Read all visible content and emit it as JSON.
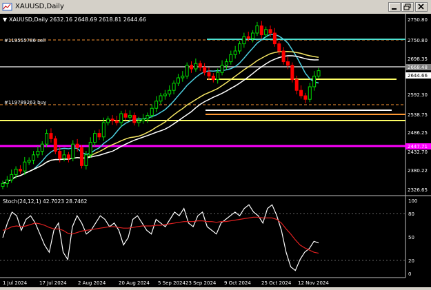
{
  "window": {
    "title": "XAUUSD,Daily",
    "minimize_label": "minimize",
    "restore_label": "restore",
    "close_label": "close"
  },
  "main_chart": {
    "header": {
      "symbol": "XAUUSD,Daily",
      "ohlc": "2632.16 2648.69 2618.81 2644.66"
    },
    "level_labels": [
      {
        "text": "#119555786 sell"
      },
      {
        "text": "#119789263 buy"
      }
    ],
    "price_axis": [
      "2750.80",
      "2698.35",
      "2668.48",
      "2644.66",
      "2592.30",
      "2538.75",
      "2486.25",
      "2432.70",
      "2380.22",
      "2326.65"
    ],
    "magenta_level": "2447.71",
    "current_price": "2644.66",
    "colors": {
      "background": "#000000",
      "candles": "#ff0000",
      "bull_candles": "#00e000",
      "ma_fast": "#4dd0e1",
      "ma_slow": "#ffffff",
      "ma_mid": "#f5e663",
      "level_cyan": "#4de0d0",
      "level_magenta": "#ff00ff",
      "level_yellow": "#ffff66",
      "level_orange": "#ff9933"
    }
  },
  "stoch": {
    "label": "Stoch(24,12,1) 42.7023 28.7462",
    "axis": [
      "100",
      "80",
      "50",
      "20",
      "0"
    ]
  },
  "time_axis": [
    "1 Jul 2024",
    "17 Jul 2024",
    "2 Aug 2024",
    "20 Aug 2024",
    "5 Sep 2024",
    "23 Sep 2024",
    "9 Oct 2024",
    "25 Oct 2024",
    "12 Nov 2024"
  ],
  "chart_data": [
    {
      "type": "candlestick",
      "title": "XAUUSD,Daily",
      "ylim": [
        2300,
        2800
      ],
      "grid": false,
      "series": [
        {
          "name": "price",
          "approx_close": [
            2330,
            2340,
            2355,
            2370,
            2365,
            2390,
            2395,
            2410,
            2420,
            2440,
            2470,
            2455,
            2420,
            2400,
            2410,
            2400,
            2440,
            2430,
            2380,
            2410,
            2445,
            2470,
            2460,
            2500,
            2510,
            2505,
            2500,
            2525,
            2515,
            2520,
            2500,
            2505,
            2510,
            2520,
            2540,
            2560,
            2575,
            2580,
            2590,
            2610,
            2625,
            2630,
            2660,
            2650,
            2665,
            2655,
            2640,
            2630,
            2620,
            2640,
            2660,
            2670,
            2690,
            2700,
            2720,
            2740,
            2735,
            2750,
            2770,
            2745,
            2760,
            2750,
            2720,
            2700,
            2670,
            2660,
            2620,
            2590,
            2575,
            2565,
            2600,
            2630,
            2645
          ]
        }
      ]
    },
    {
      "type": "line",
      "title": "Stoch(24,12,1) 42.7023 28.7462",
      "ylim": [
        0,
        100
      ],
      "series": [
        {
          "name": "main",
          "values": [
            50,
            70,
            85,
            80,
            60,
            75,
            80,
            70,
            55,
            40,
            30,
            60,
            70,
            30,
            20,
            65,
            80,
            70,
            55,
            60,
            70,
            80,
            75,
            65,
            70,
            60,
            40,
            50,
            75,
            80,
            70,
            60,
            55,
            75,
            70,
            65,
            75,
            85,
            80,
            90,
            70,
            65,
            80,
            85,
            65,
            60,
            55,
            70,
            75,
            80,
            85,
            80,
            90,
            95,
            85,
            80,
            70,
            90,
            95,
            80,
            60,
            30,
            10,
            5,
            20,
            30,
            35,
            45,
            42.7
          ]
        },
        {
          "name": "signal",
          "values": [
            60,
            62,
            65,
            66,
            65,
            66,
            68,
            70,
            69,
            67,
            64,
            62,
            62,
            60,
            56,
            55,
            57,
            59,
            60,
            61,
            62,
            63,
            64,
            65,
            65,
            64,
            63,
            63,
            64,
            65,
            66,
            66,
            66,
            67,
            67,
            68,
            69,
            70,
            71,
            72,
            72,
            72,
            73,
            73,
            72,
            72,
            71,
            72,
            72,
            73,
            74,
            75,
            76,
            77,
            78,
            78,
            77,
            77,
            77,
            75,
            70,
            62,
            55,
            47,
            40,
            36,
            33,
            30,
            28.7
          ]
        }
      ]
    }
  ]
}
